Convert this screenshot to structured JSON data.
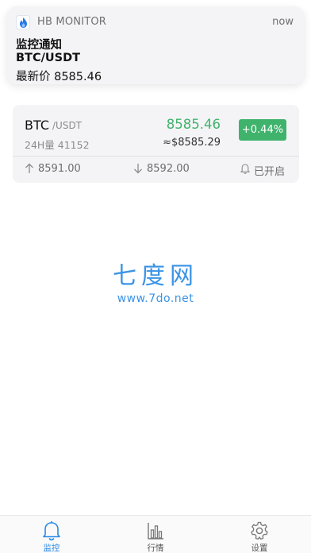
{
  "notification": {
    "app_name": "HB MONITOR",
    "time": "now",
    "title": "监控通知",
    "subtitle": "BTC/USDT",
    "body": "最新价 8585.46"
  },
  "card": {
    "symbol": "BTC",
    "quote": "/USDT",
    "volume": "24H量 41152",
    "price": "8585.46",
    "usd_price": "≈$8585.29",
    "change": "+0.44%",
    "high_alert": "8591.00",
    "low_alert": "8592.00",
    "alert_status": "已开启"
  },
  "watermark": {
    "main": "七度网",
    "sub": "www.7do.net"
  },
  "tabs": [
    {
      "label": "监控",
      "icon": "bell-icon",
      "active": true
    },
    {
      "label": "行情",
      "icon": "bar-chart-icon",
      "active": false
    },
    {
      "label": "设置",
      "icon": "gear-icon",
      "active": false
    }
  ],
  "colors": {
    "rise": "#3fb36c",
    "accent": "#2a8ae6",
    "watermark": "#3a93e6"
  }
}
